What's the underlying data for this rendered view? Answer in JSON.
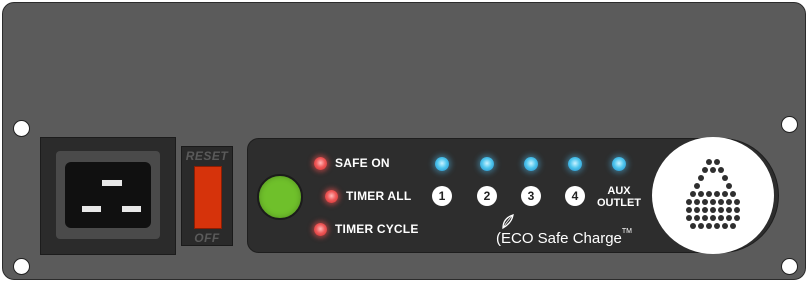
{
  "breaker": {
    "top_label": "RESET",
    "bottom_label": "OFF"
  },
  "indicators": [
    {
      "label": "SAFE ON",
      "color": "#f05a5a"
    },
    {
      "label": "TIMER ALL",
      "color": "#f05a5a"
    },
    {
      "label": "TIMER CYCLE",
      "color": "#f05a5a"
    }
  ],
  "outlets": [
    {
      "label": "1",
      "led_color": "#4fc6ee"
    },
    {
      "label": "2",
      "led_color": "#4fc6ee"
    },
    {
      "label": "3",
      "led_color": "#4fc6ee"
    },
    {
      "label": "4",
      "led_color": "#4fc6ee"
    }
  ],
  "aux": {
    "line1": "AUX",
    "line2": "OUTLET"
  },
  "brand": {
    "name": "ECO Safe Charge",
    "tm": "TM",
    "paren": "("
  },
  "colors": {
    "panel": "#5b5b5b",
    "strip": "#2d2d2d",
    "power_button": "#6fc02b",
    "breaker_switch": "#d6330b"
  },
  "icons": {
    "power_inlet": "iec-c20-inlet-icon",
    "leaf": "leaf-icon",
    "logo": "dot-matrix-bag-icon"
  }
}
